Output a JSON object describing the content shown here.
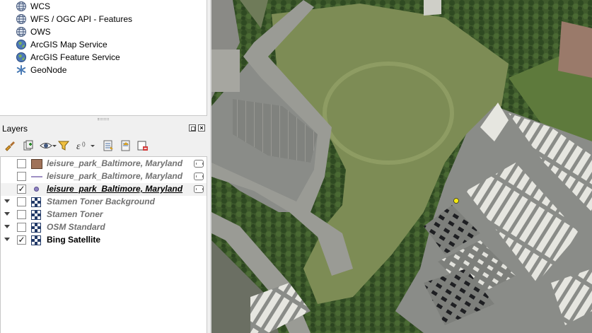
{
  "browser": {
    "items": [
      {
        "label": "WCS",
        "icon": "globe-icon"
      },
      {
        "label": "WFS / OGC API - Features",
        "icon": "globe-icon"
      },
      {
        "label": "OWS",
        "icon": "globe-icon"
      },
      {
        "label": "ArcGIS Map Service",
        "icon": "arcgis-globe-icon"
      },
      {
        "label": "ArcGIS Feature Service",
        "icon": "arcgis-globe-icon"
      },
      {
        "label": "GeoNode",
        "icon": "geonode-icon"
      }
    ]
  },
  "layers_panel": {
    "title": "Layers",
    "toolbar": [
      "style-brush-icon",
      "add-group-icon",
      "visibility-eye-icon",
      "filter-icon",
      "expression-filter-icon",
      "expand-all-icon",
      "collapse-all-icon",
      "remove-layer-icon"
    ],
    "layers": [
      {
        "name": "leisure_park_Baltimore, Maryland",
        "checked": false,
        "symbol": "polygon-fill",
        "symbol_color": "#a0735a",
        "filtered": true,
        "style": "inactive"
      },
      {
        "name": "leisure_park_Baltimore, Maryland",
        "checked": false,
        "symbol": "line",
        "symbol_color": "#9e8fc4",
        "filtered": true,
        "style": "inactive"
      },
      {
        "name": "leisure_park_Baltimore, Maryland",
        "checked": true,
        "symbol": "point",
        "symbol_color": "#8e82c2",
        "filtered": true,
        "style": "active"
      },
      {
        "name": "Stamen Toner Background",
        "checked": false,
        "symbol": "raster",
        "expandable": true,
        "style": "inactive"
      },
      {
        "name": "Stamen Toner",
        "checked": false,
        "symbol": "raster",
        "expandable": true,
        "style": "inactive"
      },
      {
        "name": "OSM Standard",
        "checked": false,
        "symbol": "raster",
        "expandable": true,
        "style": "inactive"
      },
      {
        "name": "Bing Satellite",
        "checked": true,
        "symbol": "raster",
        "expandable": true,
        "style": "visible"
      }
    ]
  },
  "map": {
    "point_feature_color": "#f5ea10"
  }
}
